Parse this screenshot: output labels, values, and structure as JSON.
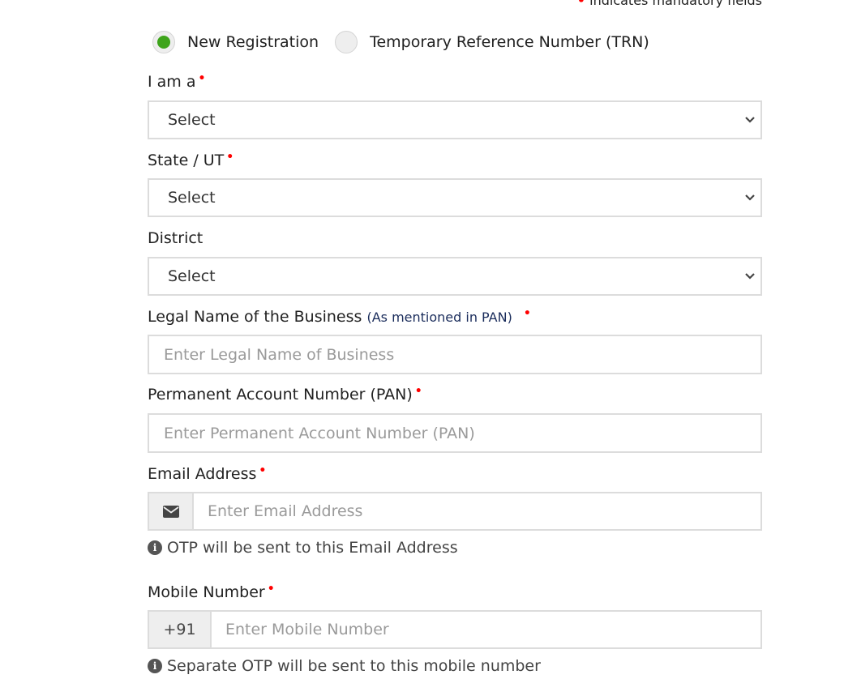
{
  "mandatory_note": "indicates mandatory fields",
  "registration_type": {
    "options": [
      {
        "label": "New Registration",
        "checked": true
      },
      {
        "label": "Temporary Reference Number (TRN)",
        "checked": false
      }
    ]
  },
  "fields": {
    "i_am_a": {
      "label": "I am a",
      "required": true,
      "value": "Select"
    },
    "state_ut": {
      "label": "State / UT",
      "required": true,
      "value": "Select"
    },
    "district": {
      "label": "District",
      "required": false,
      "value": "Select"
    },
    "legal_name": {
      "label": "Legal Name of the Business",
      "sublabel": "(As mentioned in PAN)",
      "required": true,
      "placeholder": "Enter Legal Name of Business",
      "value": ""
    },
    "pan": {
      "label": "Permanent Account Number (PAN)",
      "required": true,
      "placeholder": "Enter Permanent Account Number (PAN)",
      "value": ""
    },
    "email": {
      "label": "Email Address",
      "required": true,
      "icon": "envelope-icon",
      "placeholder": "Enter Email Address",
      "value": "",
      "help": "OTP will be sent to this Email Address"
    },
    "mobile": {
      "label": "Mobile Number",
      "required": true,
      "country_code": "+91",
      "placeholder": "Enter Mobile Number",
      "value": "",
      "help": "Separate OTP will be sent to this mobile number"
    }
  },
  "colors": {
    "required_dot": "#ff0000",
    "radio_checked": "#3ea41b",
    "sublabel": "#1a2c5b"
  }
}
